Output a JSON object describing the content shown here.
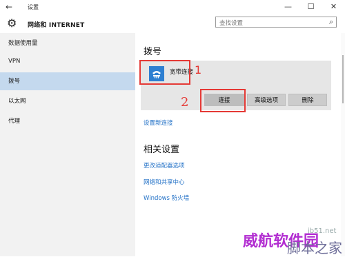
{
  "window": {
    "title": "设置",
    "controls": [
      "—",
      "☐",
      "✕"
    ]
  },
  "header": {
    "section": "网络和 INTERNET"
  },
  "search": {
    "placeholder": "查找设置"
  },
  "sidebar": {
    "items": [
      {
        "label": "数据使用量"
      },
      {
        "label": "VPN"
      },
      {
        "label": "拨号",
        "selected": true
      },
      {
        "label": "以太网"
      },
      {
        "label": "代理"
      }
    ]
  },
  "main": {
    "heading": "拨号",
    "connection": {
      "name": "宽带连接",
      "icon": "dialup-phone-icon"
    },
    "buttons": {
      "connect": "连接",
      "advanced": "高级选项",
      "delete": "删除"
    },
    "setup_link": "设置新连接",
    "related_heading": "相关设置",
    "related_links": [
      "更改适配器选项",
      "网络和共享中心",
      "Windows 防火墙"
    ]
  },
  "annotations": {
    "mark1": "1",
    "mark2": "2"
  },
  "watermark": {
    "text1": "威航软件园",
    "text2": "脚本之家",
    "text3": "jb51.net"
  },
  "colors": {
    "accent": "#2e7fd1",
    "selected_nav": "#c4d9ee",
    "link": "#1f6fc6",
    "annotation": "#e53935"
  }
}
